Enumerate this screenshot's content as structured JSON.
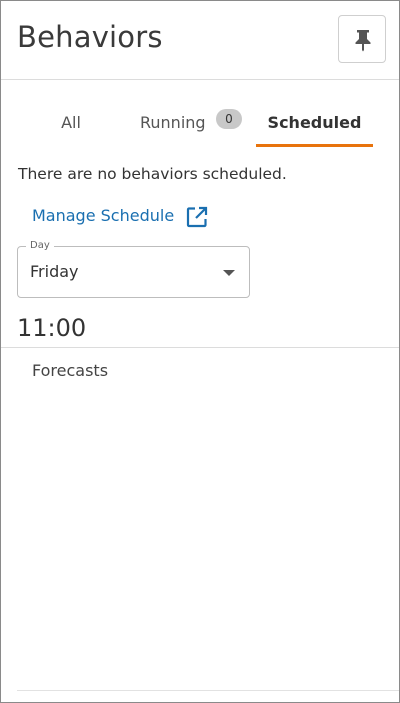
{
  "header": {
    "title": "Behaviors",
    "pin_icon": "pin-icon"
  },
  "tabs": [
    {
      "label": "All",
      "active": false
    },
    {
      "label": "Running",
      "badge": "0",
      "active": false
    },
    {
      "label": "Scheduled",
      "active": true
    }
  ],
  "scheduled": {
    "empty_message": "There are no behaviors scheduled.",
    "manage_link_label": "Manage Schedule",
    "manage_link_icon": "external-link-icon",
    "day_select": {
      "label": "Day",
      "value": "Friday"
    },
    "time": "11:00",
    "items": [
      "Forecasts"
    ]
  },
  "colors": {
    "accent": "#e8730c",
    "link": "#1a6fb0",
    "badge_bg": "#c8c8c8"
  }
}
